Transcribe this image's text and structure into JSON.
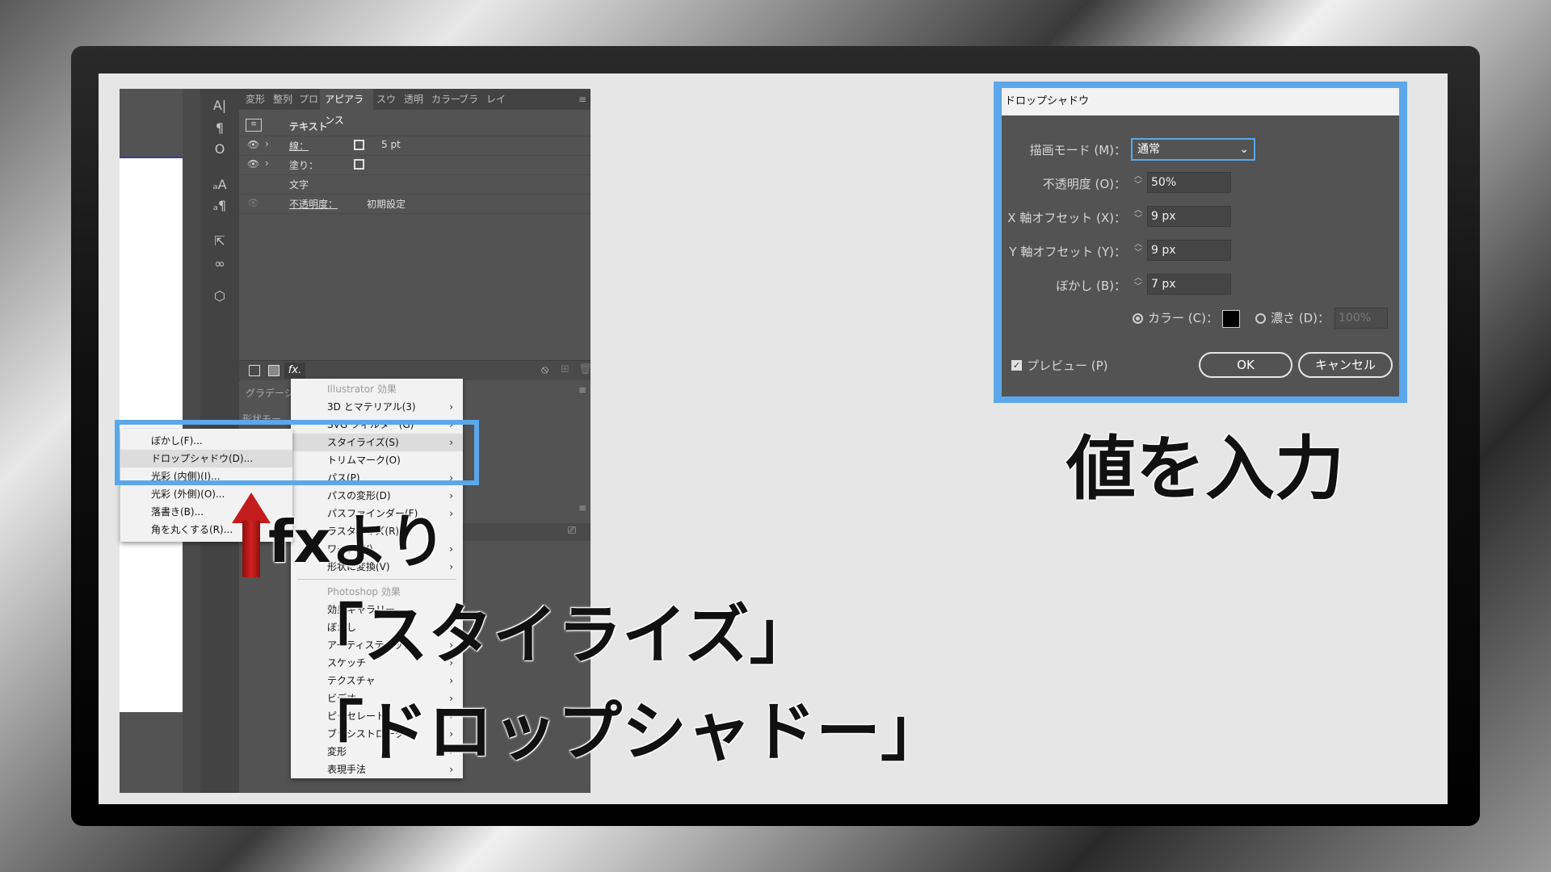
{
  "illustrator": {
    "tabs": [
      "変形",
      "整列",
      "プロパ",
      "アピアランス",
      "スウォ",
      "透明",
      "カラー",
      "ブラシ",
      "レイヤ"
    ],
    "appearance": {
      "object_type": "テキスト",
      "stroke_label": "線：",
      "stroke_value": "5 pt",
      "fill_label": "塗り：",
      "characters_label": "文字",
      "opacity_label": "不透明度：",
      "opacity_value": "初期設定"
    },
    "fx_label": "fx.",
    "gradient_tab": "グラデーシ",
    "shape_mode_label": "形状モー",
    "effect_menu": {
      "illustrator_header": "Illustrator 効果",
      "items": [
        {
          "label": "3D とマテリアル(3)",
          "submenu": true
        },
        {
          "label": "SVG フィルター(G)",
          "submenu": true
        },
        {
          "label": "スタイライズ(S)",
          "submenu": true
        },
        {
          "label": "トリムマーク(O)",
          "submenu": false
        },
        {
          "label": "パス(P)",
          "submenu": true
        },
        {
          "label": "パスの変形(D)",
          "submenu": true
        },
        {
          "label": "パスファインダー(F)",
          "submenu": true
        },
        {
          "label": "ラスタライズ(R)...",
          "submenu": false
        },
        {
          "label": "ワープ(W)",
          "submenu": true
        },
        {
          "label": "形状に変換(V)",
          "submenu": true
        }
      ],
      "photoshop_header": "Photoshop 効果",
      "ps_items": [
        {
          "label": "効果ギャラリー..."
        },
        {
          "label": "ぼかし",
          "submenu": true
        },
        {
          "label": "アーティスティック",
          "submenu": true
        },
        {
          "label": "スケッチ",
          "submenu": true
        },
        {
          "label": "テクスチャ",
          "submenu": true
        },
        {
          "label": "ビデオ",
          "submenu": true
        },
        {
          "label": "ピクセレート",
          "submenu": true
        },
        {
          "label": "ブラシストローク",
          "submenu": true
        },
        {
          "label": "変形",
          "submenu": true
        },
        {
          "label": "表現手法",
          "submenu": true
        }
      ]
    },
    "stylize_submenu": [
      "ぼかし(F)...",
      "ドロップシャドウ(D)...",
      "光彩 (内側)(I)...",
      "光彩 (外側)(O)...",
      "落書き(B)...",
      "角を丸くする(R)..."
    ]
  },
  "callouts": {
    "from_fx": "fxより",
    "stylize": "「スタイライズ」",
    "drop_shadow": "「ドロップシャドー」",
    "enter_values": "値を入力"
  },
  "dialog": {
    "title": "ドロップシャドウ",
    "mode_label": "描画モード (M)：",
    "mode_value": "通常",
    "opacity_label": "不透明度 (O)：",
    "opacity_value": "50%",
    "x_offset_label": "X 軸オフセット (X)：",
    "x_offset_value": "9 px",
    "y_offset_label": "Y 軸オフセット (Y)：",
    "y_offset_value": "9 px",
    "blur_label": "ぼかし (B)：",
    "blur_value": "7 px",
    "color_label": "カラー (C)：",
    "darkness_label": "濃さ (D)：",
    "darkness_value": "100%",
    "preview_label": "プレビュー (P)",
    "ok_label": "OK",
    "cancel_label": "キャンセル"
  },
  "colors": {
    "highlight": "#5ba7ea",
    "panel": "#535353",
    "arrow": "#c41c1c"
  }
}
